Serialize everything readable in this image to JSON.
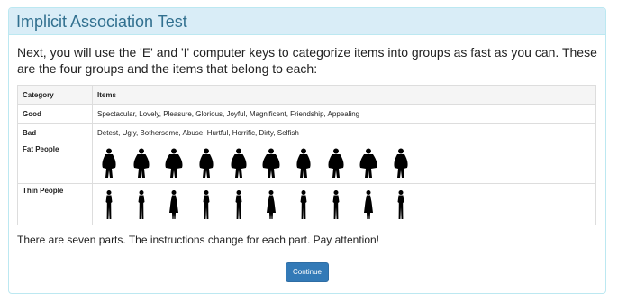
{
  "panel": {
    "title": "Implicit Association Test"
  },
  "intro": "Next, you will use the 'E' and 'I' computer keys to categorize items into groups as fast as you can. These are the four groups and the items that belong to each:",
  "table": {
    "headers": [
      "Category",
      "Items"
    ],
    "rows": [
      {
        "category": "Good",
        "items": "Spectacular, Lovely, Pleasure, Glorious, Joyful, Magnificent, Friendship, Appealing"
      },
      {
        "category": "Bad",
        "items": "Detest, Ugly, Bothersome, Abuse, Hurtful, Horrific, Dirty, Selfish"
      },
      {
        "category": "Fat People",
        "images": [
          "fat-person-silhouette-1",
          "fat-person-silhouette-2",
          "fat-person-silhouette-3",
          "fat-person-silhouette-4",
          "fat-person-silhouette-5",
          "fat-person-silhouette-6",
          "fat-person-silhouette-7",
          "fat-person-silhouette-8",
          "fat-person-silhouette-9",
          "fat-person-silhouette-10"
        ]
      },
      {
        "category": "Thin People",
        "images": [
          "thin-person-silhouette-1",
          "thin-person-silhouette-2",
          "thin-person-silhouette-3",
          "thin-person-silhouette-4",
          "thin-person-silhouette-5",
          "thin-person-silhouette-6",
          "thin-person-silhouette-7",
          "thin-person-silhouette-8",
          "thin-person-silhouette-9",
          "thin-person-silhouette-10"
        ]
      }
    ]
  },
  "notice": "There are seven parts. The instructions change for each part. Pay attention!",
  "continue_label": "Continue",
  "colors": {
    "heading_bg": "#d9edf7",
    "heading_text": "#31708f",
    "button_bg": "#337ab7",
    "silhouette": "#000000"
  }
}
